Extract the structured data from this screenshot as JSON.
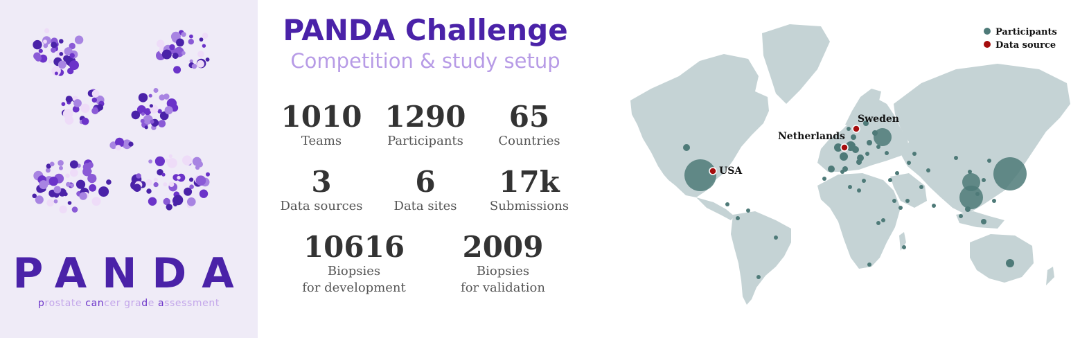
{
  "logo": {
    "word": "PANDA",
    "tagline_parts": [
      {
        "t": "p",
        "hl": true
      },
      {
        "t": "rostate ",
        "hl": false
      },
      {
        "t": "c",
        "hl": true
      },
      {
        "t": "an",
        "hl": true
      },
      {
        "t": "cer ",
        "hl": false
      },
      {
        "t": "gra",
        "hl": false
      },
      {
        "t": "d",
        "hl": true
      },
      {
        "t": "e ",
        "hl": false
      },
      {
        "t": "a",
        "hl": true
      },
      {
        "t": "ssessment",
        "hl": false
      }
    ]
  },
  "header": {
    "title": "PANDA Challenge",
    "subtitle": "Competition & study setup"
  },
  "stats": {
    "teams": {
      "value": "1010",
      "label": "Teams"
    },
    "participants": {
      "value": "1290",
      "label": "Participants"
    },
    "countries": {
      "value": "65",
      "label": "Countries"
    },
    "data_sources": {
      "value": "3",
      "label": "Data sources"
    },
    "data_sites": {
      "value": "6",
      "label": "Data sites"
    },
    "submissions": {
      "value": "17k",
      "label": "Submissions"
    },
    "dev_biopsies": {
      "value": "10616",
      "label": "Biopsies\nfor development"
    },
    "val_biopsies": {
      "value": "2009",
      "label": "Biopsies\nfor validation"
    }
  },
  "map": {
    "legend": {
      "participants": "Participants",
      "data_source": "Data source"
    },
    "labels": {
      "usa": "USA",
      "netherlands": "Netherlands",
      "sweden": "Sweden"
    },
    "colors": {
      "land": "#c5d3d5",
      "participants": "#4e7a78",
      "source": "#a50d0d"
    }
  },
  "colors": {
    "purple_dark": "#4a22a8",
    "purple_light": "#b79be6",
    "panel_bg": "#efebf7"
  }
}
